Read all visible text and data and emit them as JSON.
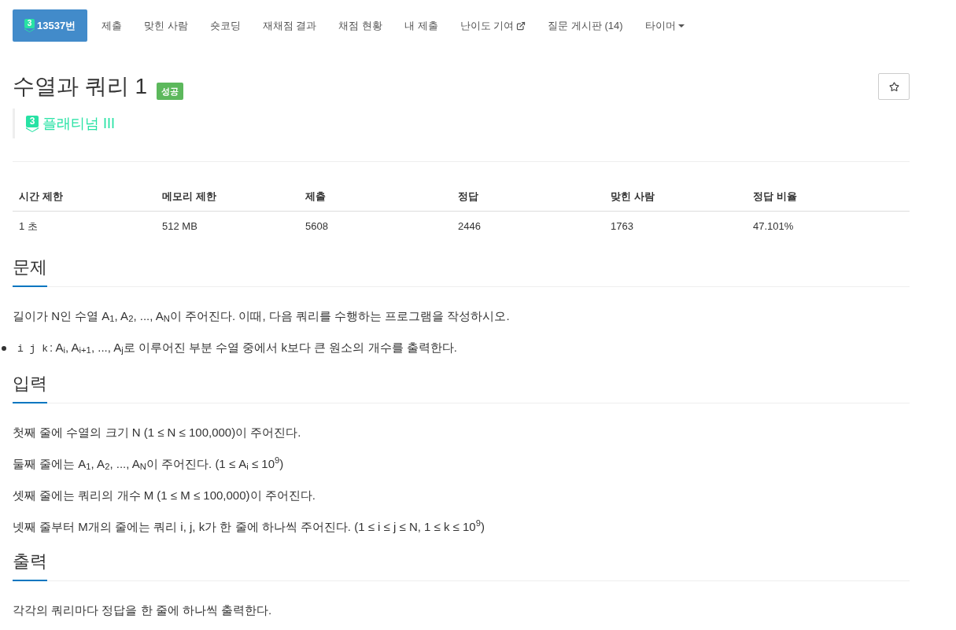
{
  "nav": {
    "tabs": [
      {
        "kind": "problem",
        "tier_number": "3",
        "label": "13537번",
        "selected": true
      },
      {
        "kind": "link",
        "label": "제출",
        "selected": false
      },
      {
        "kind": "link",
        "label": "맞힌 사람",
        "selected": false
      },
      {
        "kind": "link",
        "label": "숏코딩",
        "selected": false
      },
      {
        "kind": "link",
        "label": "재채점 결과",
        "selected": false
      },
      {
        "kind": "link",
        "label": "채점 현황",
        "selected": false
      },
      {
        "kind": "link",
        "label": "내 제출",
        "selected": false
      },
      {
        "kind": "external",
        "label": "난이도 기여",
        "selected": false
      },
      {
        "kind": "link",
        "label": "질문 게시판 (14)",
        "selected": false
      },
      {
        "kind": "dropdown",
        "label": "타이머",
        "selected": false
      }
    ]
  },
  "problem": {
    "title": "수열과 쿼리 1",
    "result_badge": "성공",
    "bookmarked": false,
    "tier": {
      "number": "3",
      "name": "플래티넘 III"
    }
  },
  "stats_table": {
    "columns": [
      "시간 제한",
      "메모리 제한",
      "제출",
      "정답",
      "맞힌 사람",
      "정답 비율"
    ],
    "rows": [
      [
        "1 초",
        "512 MB",
        "5608",
        "2446",
        "1763",
        "47.101%"
      ]
    ]
  },
  "sections": [
    {
      "title": "문제",
      "blocks": [
        {
          "kind": "paragraph",
          "text": "길이가 N인 수열 A$_{1}$, A$_{2}$, ..., A$_{N}$이 주어진다. 이때, 다음 쿼리를 수행하는 프로그램을 작성하시오."
        },
        {
          "kind": "bullet",
          "code": "i j k",
          "text": ": A$_{i}$, A$_{i+1}$, ..., A$_{j}$로 이루어진 부분 수열 중에서 k보다 큰 원소의 개수를 출력한다."
        }
      ]
    },
    {
      "title": "입력",
      "blocks": [
        {
          "kind": "paragraph",
          "text": "첫째 줄에 수열의 크기 N (1 ≤ N ≤ 100,000)이 주어진다."
        },
        {
          "kind": "paragraph",
          "text": "둘째 줄에는 A$_{1}$, A$_{2}$, ..., A$_{N}$이 주어진다. (1 ≤ A$_{i}$ ≤ 10$^{9}$)"
        },
        {
          "kind": "paragraph",
          "text": "셋째 줄에는 쿼리의 개수 M (1 ≤ M ≤ 100,000)이 주어진다."
        },
        {
          "kind": "paragraph",
          "text": "넷째 줄부터 M개의 줄에는 쿼리 i, j, k가 한 줄에 하나씩 주어진다. (1 ≤ i ≤ j ≤ N, 1 ≤ k ≤ 10$^{9}$)"
        }
      ]
    },
    {
      "title": "출력",
      "blocks": [
        {
          "kind": "paragraph",
          "text": "각각의 쿼리마다 정답을 한 줄에 하나씩 출력한다."
        }
      ]
    }
  ]
}
